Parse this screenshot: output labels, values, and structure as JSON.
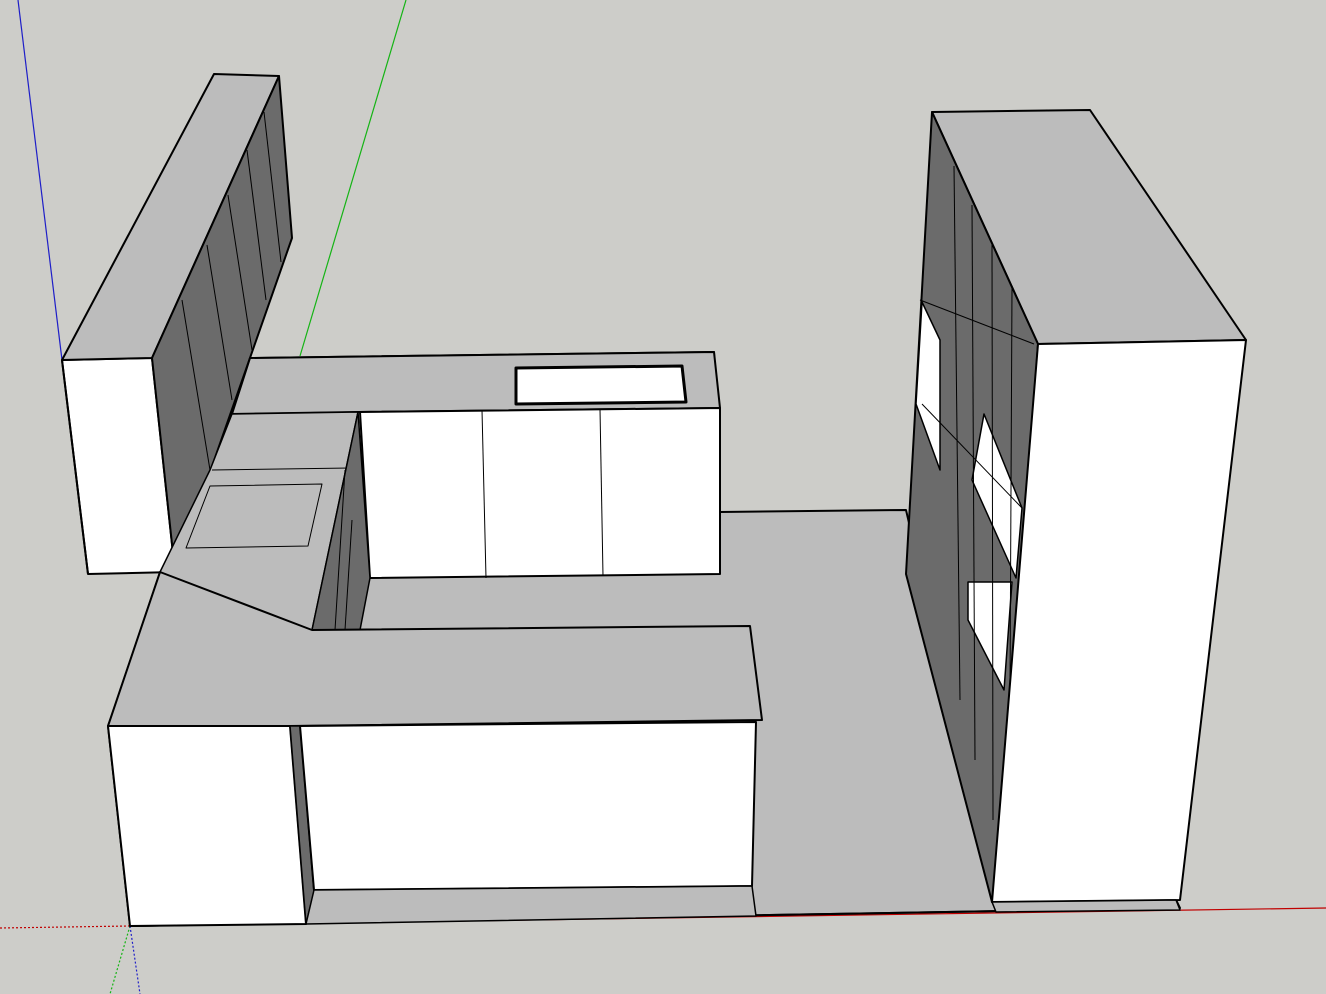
{
  "app": {
    "view": "3d-model-viewport"
  },
  "colors": {
    "sky_background": "#cdcdc9",
    "face_light": "#ffffff",
    "face_mid": "#bcbcbc",
    "face_dark": "#6b6b6b",
    "edge": "#000000",
    "axis_red": "#c00000",
    "axis_green": "#14b414",
    "axis_blue": "#1e1ec8"
  },
  "model": {
    "components": [
      "wall-cabinets-left",
      "kitchen-counter-u",
      "tall-cabinets-right",
      "floor-slab"
    ]
  }
}
